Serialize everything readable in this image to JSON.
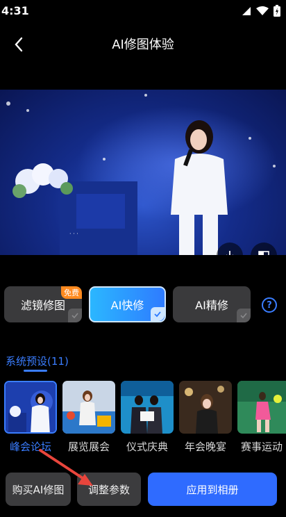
{
  "status_bar": {
    "time": "4:31"
  },
  "header": {
    "title": "AI修图体验"
  },
  "modes": [
    {
      "label": "滤镜修图",
      "badge": "免费",
      "active": false
    },
    {
      "label": "AI快修",
      "active": true
    },
    {
      "label": "AI精修",
      "active": false
    }
  ],
  "presets": {
    "title": "系统预设(11)",
    "items": [
      {
        "label": "峰会论坛",
        "active": true
      },
      {
        "label": "展览展会"
      },
      {
        "label": "仪式庆典"
      },
      {
        "label": "年会晚宴"
      },
      {
        "label": "赛事运动"
      }
    ]
  },
  "buttons": {
    "buy": "购买AI修图",
    "adjust": "调整参数",
    "apply": "应用到相册"
  },
  "icons": [
    "signal-icon",
    "wifi-icon",
    "battery-icon",
    "back-icon",
    "download-icon",
    "compare-icon",
    "help-icon",
    "check-icon"
  ],
  "colors": {
    "accent": "#3a7dff",
    "badge": "#ff8a1f",
    "arrow": "#e8453c"
  }
}
